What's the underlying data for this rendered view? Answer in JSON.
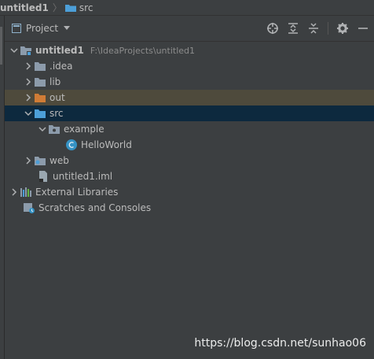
{
  "breadcrumb": {
    "root": "untitled1",
    "folder": "src"
  },
  "toolbar": {
    "view_label": "Project"
  },
  "tree": {
    "root": {
      "label": "untitled1",
      "path": "F:\\IdeaProjects\\untitled1"
    },
    "items": [
      {
        "label": ".idea"
      },
      {
        "label": "lib"
      },
      {
        "label": "out"
      },
      {
        "label": "src"
      },
      {
        "label": "example"
      },
      {
        "label": "HelloWorld"
      },
      {
        "label": "web"
      },
      {
        "label": "untitled1.iml"
      },
      {
        "label": "External Libraries"
      },
      {
        "label": "Scratches and Consoles"
      }
    ]
  },
  "watermark": "https://blog.csdn.net/sunhao06",
  "colors": {
    "background": "#3c3f41",
    "folder": "#8c9bab",
    "out_folder": "#d07c36",
    "src_folder": "#4c9fd8",
    "out_row": "#4e4a3c",
    "src_row": "#0d293e"
  }
}
